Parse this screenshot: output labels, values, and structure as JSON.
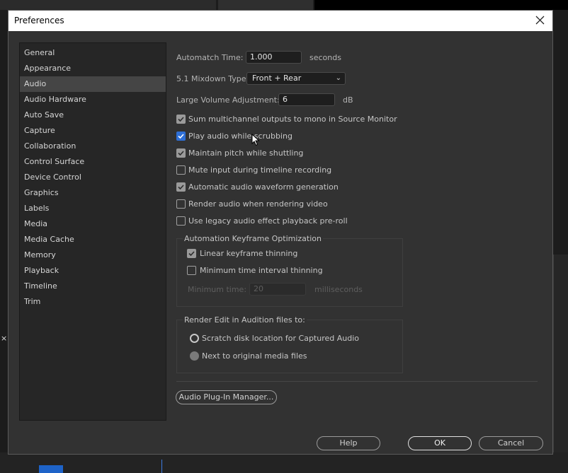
{
  "dialog": {
    "title": "Preferences"
  },
  "sidebar": {
    "items": [
      {
        "label": "General"
      },
      {
        "label": "Appearance"
      },
      {
        "label": "Audio",
        "selected": true
      },
      {
        "label": "Audio Hardware"
      },
      {
        "label": "Auto Save"
      },
      {
        "label": "Capture"
      },
      {
        "label": "Collaboration"
      },
      {
        "label": "Control Surface"
      },
      {
        "label": "Device Control"
      },
      {
        "label": "Graphics"
      },
      {
        "label": "Labels"
      },
      {
        "label": "Media"
      },
      {
        "label": "Media Cache"
      },
      {
        "label": "Memory"
      },
      {
        "label": "Playback"
      },
      {
        "label": "Timeline"
      },
      {
        "label": "Trim"
      }
    ]
  },
  "audio": {
    "automatch_label": "Automatch Time:",
    "automatch_value": "1.000",
    "automatch_unit": "seconds",
    "mixdown_label": "5.1 Mixdown Type:",
    "mixdown_value": "Front + Rear",
    "volume_label": "Large Volume Adjustment:",
    "volume_value": "6",
    "volume_unit": "dB",
    "checkboxes": [
      {
        "label": "Sum multichannel outputs to mono in Source Monitor",
        "checked": true
      },
      {
        "label": "Play audio while scrubbing",
        "checked": true
      },
      {
        "label": "Maintain pitch while shuttling",
        "checked": true
      },
      {
        "label": "Mute input during timeline recording",
        "checked": false
      },
      {
        "label": "Automatic audio waveform generation",
        "checked": true
      },
      {
        "label": "Render audio when rendering video",
        "checked": false
      },
      {
        "label": "Use legacy audio effect playback pre-roll",
        "checked": false
      }
    ],
    "keyframe_group": {
      "title": "Automation Keyframe Optimization",
      "linear_label": "Linear keyframe thinning",
      "linear_checked": true,
      "min_interval_label": "Minimum time interval thinning",
      "min_interval_checked": false,
      "min_time_label": "Minimum time:",
      "min_time_value": "20",
      "min_time_unit": "milliseconds"
    },
    "render_group": {
      "title": "Render Edit in Audition files to:",
      "option1": "Scratch disk location for Captured Audio",
      "option2": "Next to original media files"
    },
    "plugin_manager_label": "Audio Plug-In Manager..."
  },
  "footer": {
    "help": "Help",
    "ok": "OK",
    "cancel": "Cancel"
  }
}
